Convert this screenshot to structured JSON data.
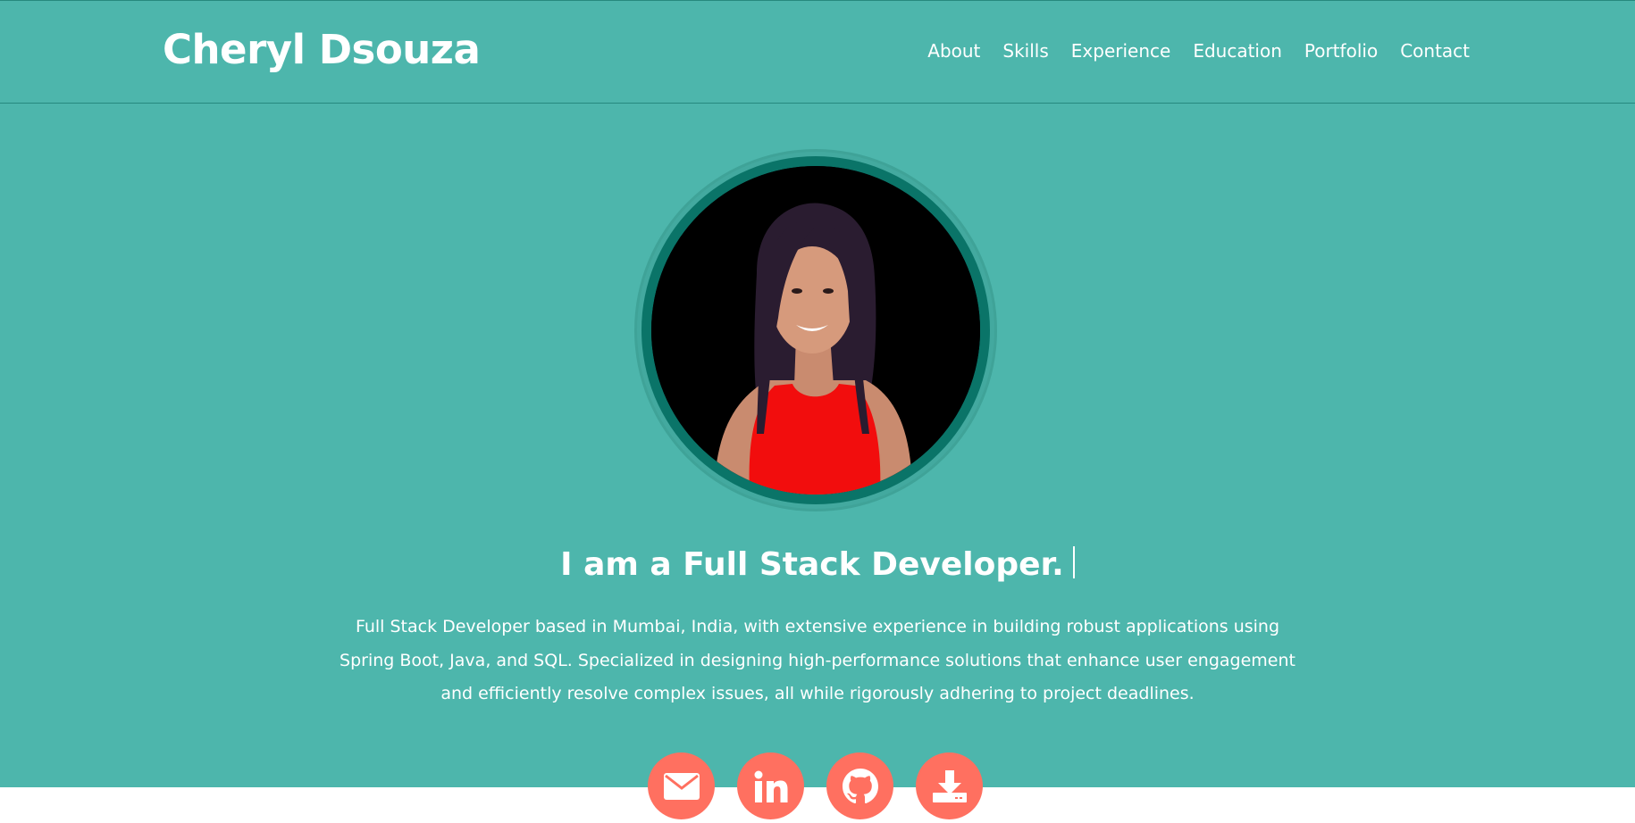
{
  "header": {
    "brand": "Cheryl Dsouza",
    "nav": [
      "About",
      "Skills",
      "Experience",
      "Education",
      "Portfolio",
      "Contact"
    ]
  },
  "hero": {
    "headline": "I am a Full Stack Developer.",
    "bio": "Full Stack Developer based in Mumbai, India, with extensive experience in building robust applications using Spring Boot, Java, and SQL. Specialized in designing high-performance solutions that enhance user engagement and efficiently resolve complex issues, all while rigorously adhering to project deadlines.",
    "socials": [
      {
        "icon": "envelope-icon"
      },
      {
        "icon": "linkedin-icon"
      },
      {
        "icon": "github-icon"
      },
      {
        "icon": "download-icon"
      }
    ]
  },
  "colors": {
    "hero_bg": "#4db6ac",
    "avatar_border": "#0a7468",
    "social_bg": "#ff7060",
    "text": "#ffffff"
  }
}
